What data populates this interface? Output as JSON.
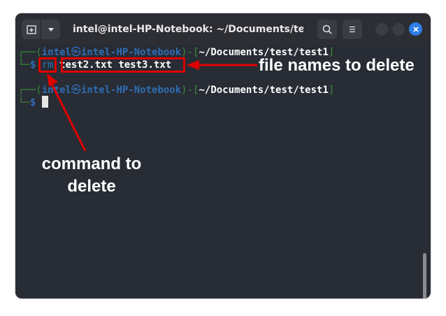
{
  "window": {
    "title": "intel@intel-HP-Notebook: ~/Documents/tes...",
    "accent_color": "#2e7fe8",
    "icons": {
      "new_tab": "new-tab-icon",
      "dropdown": "chevron-down-icon",
      "search": "search-icon",
      "menu": "hamburger-menu-icon",
      "close": "close-icon"
    }
  },
  "terminal": {
    "prompt1": {
      "frame_open": "┌──(",
      "user": "intel",
      "skull": "㉿",
      "host": "intel-HP-Notebook",
      "frame_mid": ")-[",
      "path": "~/Documents/test/test1",
      "frame_close": "]"
    },
    "command1": {
      "frame": "└─",
      "dollar": "$",
      "cmd": "rm",
      "args": "test2.txt test3.txt"
    },
    "prompt2": {
      "frame_open": "┌──(",
      "user": "intel",
      "skull": "㉿",
      "host": "intel-HP-Notebook",
      "frame_mid": ")-[",
      "path": "~/Documents/test/test1",
      "frame_close": "]"
    },
    "command2": {
      "frame": "└─",
      "dollar": "$"
    }
  },
  "annotations": {
    "file_names_label": "file names to delete",
    "command_label_line1": "command to",
    "command_label_line2": "delete",
    "highlight_color": "#e00000"
  }
}
